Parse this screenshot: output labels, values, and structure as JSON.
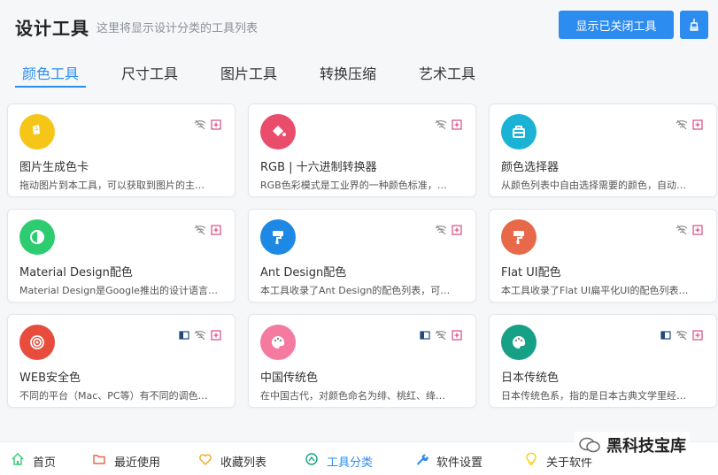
{
  "header": {
    "title": "设计工具",
    "subtitle": "这里将显示设计分类的工具列表",
    "show_closed_button": "显示已关闭工具"
  },
  "tabs": [
    {
      "label": "颜色工具",
      "active": true
    },
    {
      "label": "尺寸工具",
      "active": false
    },
    {
      "label": "图片工具",
      "active": false
    },
    {
      "label": "转换压缩",
      "active": false
    },
    {
      "label": "艺术工具",
      "active": false
    }
  ],
  "cards": [
    {
      "title": "图片生成色卡",
      "desc": "拖动图片到本工具，可以获取到图片的主…",
      "icon": "image-palette-icon",
      "color": "#f5c518"
    },
    {
      "title": "RGB | 十六进制转换器",
      "desc": "RGB色彩模式是工业界的一种颜色标准，…",
      "icon": "paint-bucket-icon",
      "color": "#ea4c6b"
    },
    {
      "title": "颜色选择器",
      "desc": "从颜色列表中自由选择需要的颜色，自动…",
      "icon": "toolbox-icon",
      "color": "#1ab3d6"
    },
    {
      "title": "Material Design配色",
      "desc": "Material Design是Google推出的设计语言…",
      "icon": "contrast-icon",
      "color": "#2ecc71"
    },
    {
      "title": "Ant Design配色",
      "desc": "本工具收录了Ant Design的配色列表，可…",
      "icon": "paint-roller-icon",
      "color": "#1e88e5"
    },
    {
      "title": "Flat UI配色",
      "desc": "本工具收录了Flat UI扁平化UI的配色列表…",
      "icon": "paint-roller-icon",
      "color": "#e8684a"
    },
    {
      "title": "WEB安全色",
      "desc": "不同的平台（Mac、PC等）有不同的调色…",
      "icon": "target-icon",
      "color": "#e84c3d"
    },
    {
      "title": "中国传统色",
      "desc": "在中国古代，对颜色命名为绯、桃红、绛…",
      "icon": "palette-icon",
      "color": "#f47aa0"
    },
    {
      "title": "日本传统色",
      "desc": "日本传统色系，指的是日本古典文学里经…",
      "icon": "palette-icon",
      "color": "#16a085"
    }
  ],
  "footer": {
    "items": [
      {
        "label": "首页",
        "icon": "home-icon",
        "color": "#2ecc71"
      },
      {
        "label": "最近使用",
        "icon": "folder-icon",
        "color": "#e8684a"
      },
      {
        "label": "收藏列表",
        "icon": "heart-icon",
        "color": "#f5a623"
      },
      {
        "label": "工具分类",
        "icon": "compass-icon",
        "color": "#16a085",
        "active": true
      },
      {
        "label": "软件设置",
        "icon": "wrench-icon",
        "color": "#2d8cf0"
      },
      {
        "label": "关于软件",
        "icon": "bulb-icon",
        "color": "#f5d018"
      }
    ]
  },
  "watermark": "黑科技宝库",
  "colors": {
    "accent": "#2d8cf0",
    "background": "#f6f7f9"
  }
}
